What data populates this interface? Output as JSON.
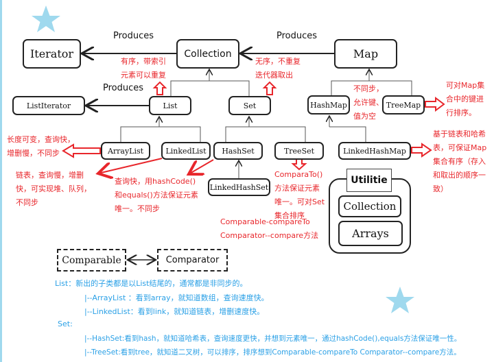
{
  "nodes": {
    "iterator": "Iterator",
    "collection": "Collection",
    "map": "Map",
    "list_iterator": "ListIterator",
    "list": "List",
    "set": "Set",
    "hashmap": "HashMap",
    "treemap": "TreeMap",
    "arraylist": "ArrayList",
    "linkedlist": "LinkedList",
    "hashset": "HashSet",
    "treeset": "TreeSet",
    "linkedhashset": "LinkedHashSet",
    "linkedhashmap": "LinkedHashMap",
    "utilitie": "Utilitie",
    "util_collection": "Collection",
    "util_arrays": "Arrays",
    "comparable": "Comparable",
    "comparator": "Comparator"
  },
  "edge_labels": {
    "produces1": "Produces",
    "produces2": "Produces",
    "produces3": "Produces"
  },
  "notes": {
    "list": "有序，带索引\n元素可以重复",
    "set": "无序，不重复\n迭代器取出",
    "hashmap": "不同步，\n允许键、\n值为空",
    "treemap": "可对Map集\n合中的键进\n行排序。",
    "arraylist": "长度可变，查询快，\n增删慢，不同步",
    "linkedlist": "链表，查询慢，增删\n快，可实现堆、队列，\n不同步",
    "hashset": "查询快，用hashCode()\n和equals()方法保证元素\n唯一。不同步",
    "treeset": "ComparaTo()\n方法保证元素\n唯一。可对Set\n集合排序",
    "compare": "Comparable-compareTo\nComparator--compare方法",
    "linkedhashmap": "基于链表和哈希\n表，可保证Map\n集合有序（存入\n和取出的顺序一\n致）"
  },
  "summary": [
    "List：新出的子类都是以List结尾的，通常都是非同步的。",
    "|--ArrayList ：看到array，就知道数组，查询速度快。",
    "|--LinkedList：看到link，就知道链表，增删速度快。",
    "Set:",
    "|--HashSet:看到hash，就知道哈希表，查询速度更快，并想到元素唯一，通过hashCode(),equals方法保证唯一性。",
    "|--TreeSet:看到tree，就知道二叉树，可以排序，排序想到Comparable-compareTo Comparator--compare方法。"
  ],
  "colors": {
    "note": "#e8262b",
    "summary": "#2aa0e6",
    "star": "#9fd9ee"
  },
  "icons": [
    "star-icon",
    "star-icon"
  ]
}
